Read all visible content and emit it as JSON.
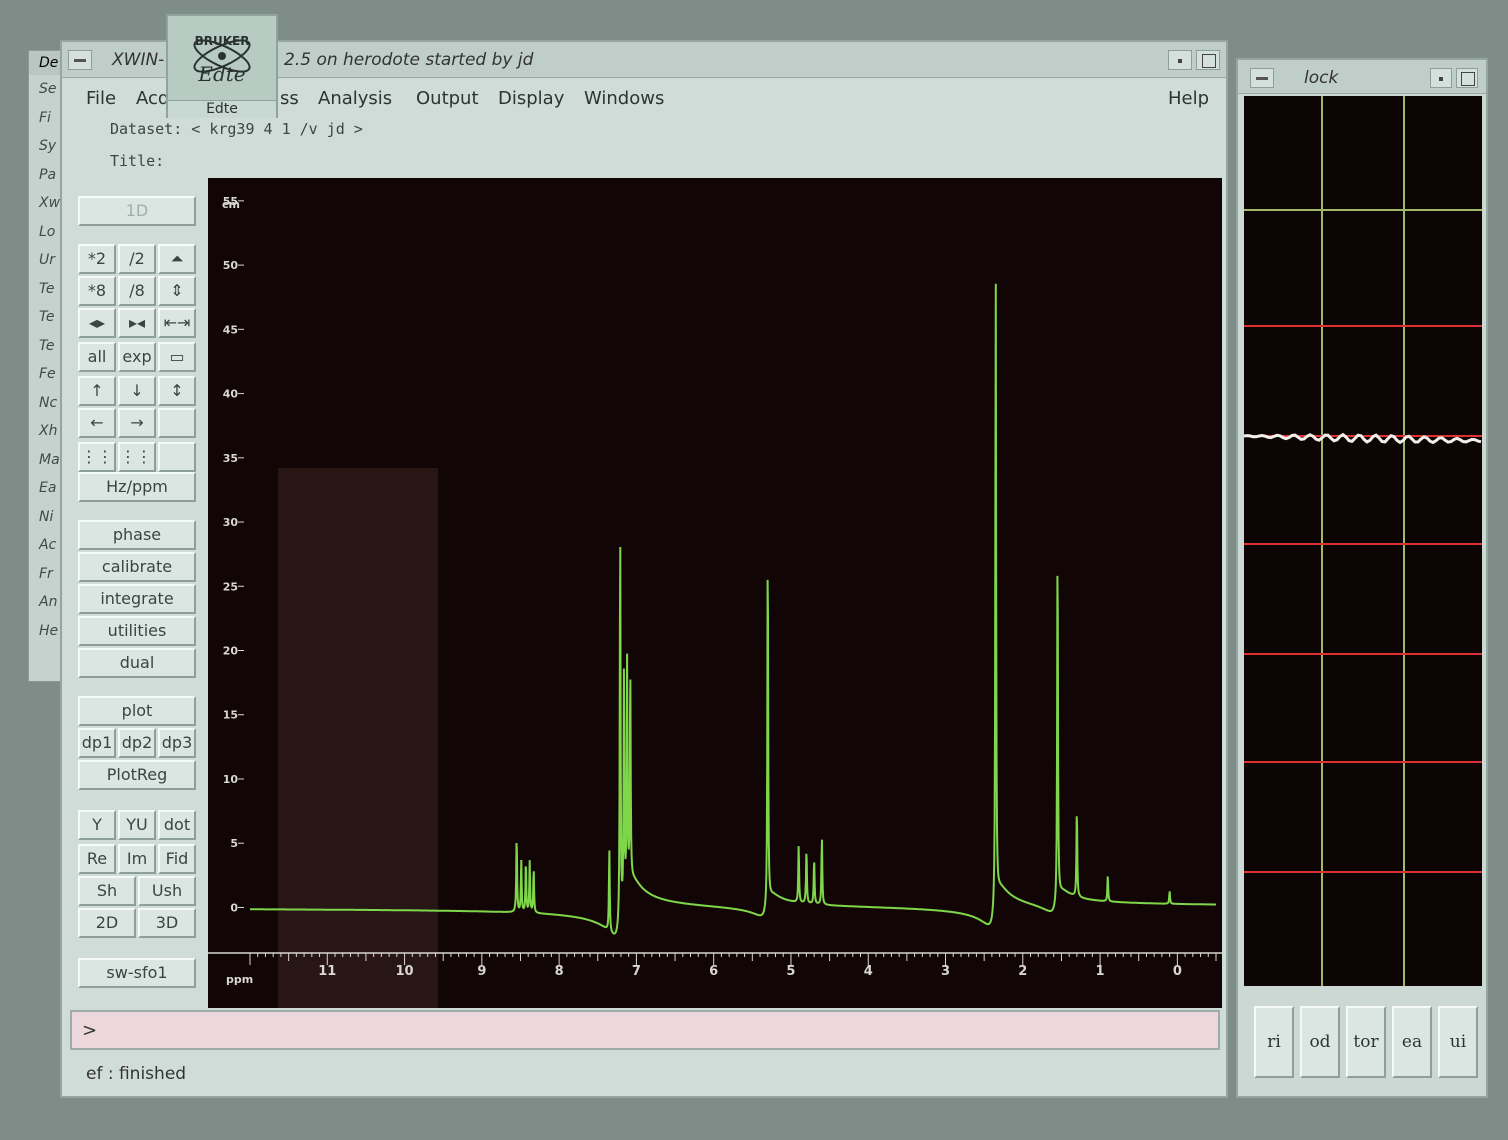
{
  "background_menu": {
    "title": "De",
    "items": [
      "De",
      "Se",
      "Fi",
      "Sy",
      "Pa",
      "Xw",
      "Lo",
      "Ur",
      "Te",
      "Te",
      "Te",
      "Fe",
      "Nc",
      "Xh",
      "Ma",
      "Ea",
      "Ni",
      "Ac",
      "Fr",
      "An",
      "He"
    ]
  },
  "main_window": {
    "title_left": "XWIN-",
    "title_right": "2.5 on herodote started by jd",
    "menu": {
      "file": "File",
      "acq": "Acq",
      "process": "ss",
      "analysis": "Analysis",
      "output": "Output",
      "display": "Display",
      "windows": "Windows",
      "help": "Help"
    },
    "dataset_line": "Dataset: < krg39 4 1 /v jd >",
    "title_line": "Title:",
    "buttons": {
      "one_d": "1D",
      "mul2": "*2",
      "div2": "/2",
      "mul8": "*8",
      "div8": "/8",
      "all": "all",
      "exp": "exp",
      "hzppm": "Hz/ppm",
      "phase": "phase",
      "calibrate": "calibrate",
      "integrate": "integrate",
      "utilities": "utilities",
      "dual": "dual",
      "plot": "plot",
      "dp1": "dp1",
      "dp2": "dp2",
      "dp3": "dp3",
      "plotreg": "PlotReg",
      "y": "Y",
      "yu": "YU",
      "dot": "dot",
      "re": "Re",
      "im": "Im",
      "fid": "Fid",
      "sh": "Sh",
      "ush": "Ush",
      "two_d": "2D",
      "three_d": "3D",
      "swsfo1": "sw-sfo1"
    },
    "command_prompt": ">",
    "status": "ef : finished"
  },
  "bruker_icon": {
    "brand": "BRUKER",
    "name": "Edte",
    "label": "Edte"
  },
  "lock_window": {
    "title": "lock",
    "buttons": [
      "ri",
      "od",
      "tor",
      "ea",
      "ui"
    ]
  },
  "chart_data": {
    "type": "line",
    "title": "",
    "xlabel": "ppm",
    "ylabel": "cm",
    "xlim": [
      12.0,
      -0.5
    ],
    "ylim": [
      -3,
      56
    ],
    "x_ticks": [
      11,
      10,
      9,
      8,
      7,
      6,
      5,
      4,
      3,
      2,
      1,
      0
    ],
    "y_ticks": [
      0,
      5,
      10,
      15,
      20,
      25,
      30,
      35,
      40,
      45,
      50,
      55
    ],
    "grid": false,
    "colors": {
      "trace": "#7fd64a",
      "axis": "#d8d8d0"
    },
    "series": [
      {
        "peaks": [
          {
            "ppm": 8.55,
            "height": 6.0
          },
          {
            "ppm": 8.49,
            "height": 4.0
          },
          {
            "ppm": 8.43,
            "height": 4.0
          },
          {
            "ppm": 8.38,
            "height": 4.0
          },
          {
            "ppm": 8.33,
            "height": 3.5
          },
          {
            "ppm": 7.35,
            "height": 6.5
          },
          {
            "ppm": 7.21,
            "height": 31.5
          },
          {
            "ppm": 7.16,
            "height": 19.0
          },
          {
            "ppm": 7.12,
            "height": 18.0
          },
          {
            "ppm": 7.08,
            "height": 17.0
          },
          {
            "ppm": 5.3,
            "height": 28.5
          },
          {
            "ppm": 4.9,
            "height": 4.5
          },
          {
            "ppm": 4.8,
            "height": 4.3
          },
          {
            "ppm": 4.7,
            "height": 3.6
          },
          {
            "ppm": 4.6,
            "height": 5.2
          },
          {
            "ppm": 2.35,
            "height": 50.0
          },
          {
            "ppm": 1.55,
            "height": 28.5
          },
          {
            "ppm": 1.3,
            "height": 7.0
          },
          {
            "ppm": 0.9,
            "height": 2.0
          },
          {
            "ppm": 0.1,
            "height": 1.0
          }
        ]
      }
    ]
  }
}
